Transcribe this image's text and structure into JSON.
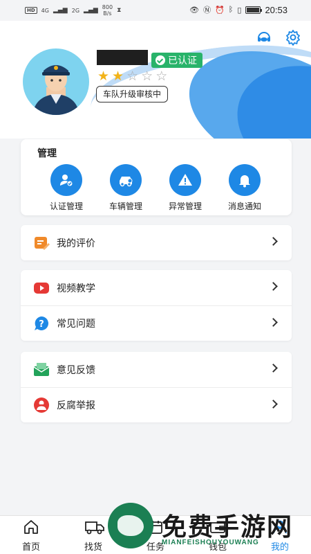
{
  "status_bar": {
    "hd": "HD",
    "net1": "4G",
    "net2": "2G",
    "speed_value": "800",
    "speed_unit": "B/s",
    "time": "20:53",
    "battery_level": 0.95
  },
  "header": {
    "support_icon": "headset-icon",
    "settings_icon": "gear-icon",
    "verified_label": "已认证",
    "rating": {
      "filled": 2,
      "total": 5
    },
    "team_status": "车队升级审核中"
  },
  "manage": {
    "title": "管理",
    "items": [
      {
        "label": "认证管理",
        "icon": "user-verify-icon"
      },
      {
        "label": "车辆管理",
        "icon": "car-icon"
      },
      {
        "label": "异常管理",
        "icon": "warning-icon"
      },
      {
        "label": "消息通知",
        "icon": "bell-icon"
      }
    ]
  },
  "menu": {
    "group1": [
      {
        "label": "我的评价",
        "icon": "review-icon"
      }
    ],
    "group2": [
      {
        "label": "视频教学",
        "icon": "video-play-icon"
      },
      {
        "label": "常见问题",
        "icon": "question-icon"
      }
    ],
    "group3": [
      {
        "label": "意见反馈",
        "icon": "feedback-mail-icon"
      },
      {
        "label": "反腐举报",
        "icon": "report-icon"
      }
    ]
  },
  "tabbar": {
    "items": [
      {
        "label": "首页",
        "icon": "home-icon"
      },
      {
        "label": "找货",
        "icon": "truck-icon"
      },
      {
        "label": "任务",
        "icon": "calendar-icon"
      },
      {
        "label": "钱包",
        "icon": "wallet-icon"
      },
      {
        "label": "我的",
        "icon": "profile-icon"
      }
    ],
    "active_color": "#1e88e5"
  },
  "watermark": {
    "text": "免费手游网",
    "sub": "MIANFEISHOUYOUWANG"
  },
  "colors": {
    "accent": "#1e88e5",
    "verified": "#29b36a",
    "star": "#f2b319"
  }
}
